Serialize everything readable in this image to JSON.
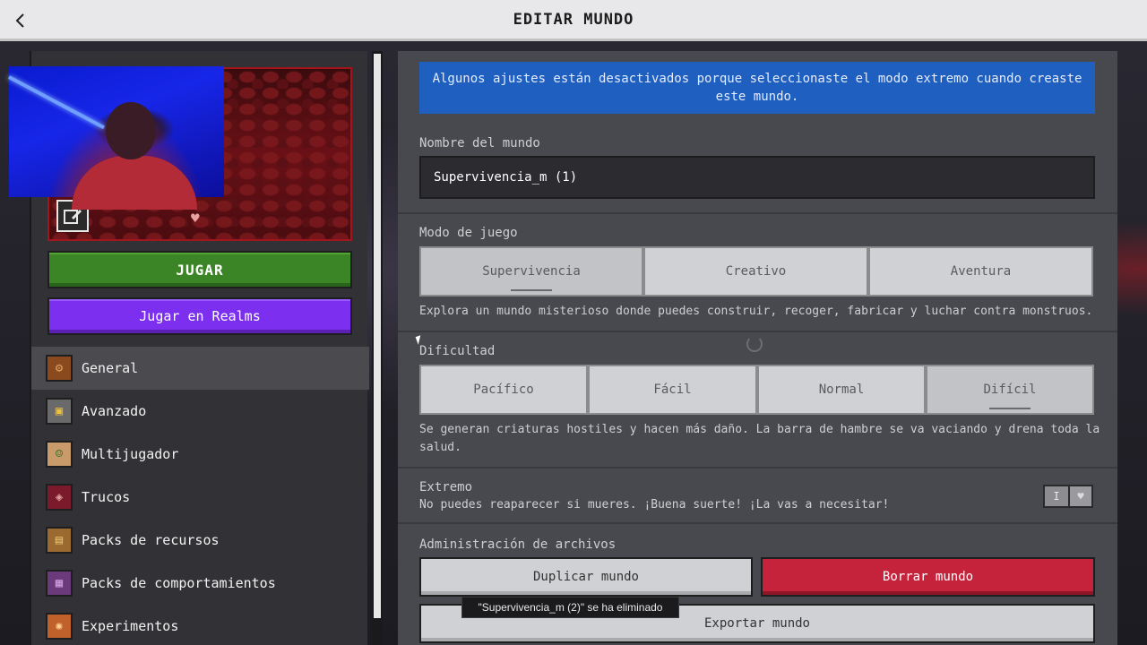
{
  "header": {
    "title": "EDITAR MUNDO",
    "back_icon": "chevron-left-icon"
  },
  "left": {
    "play_label": "JUGAR",
    "realms_label": "Jugar en Realms",
    "nav": [
      {
        "label": "General",
        "icon": "gear-icon",
        "active": true
      },
      {
        "label": "Avanzado",
        "icon": "furnace-icon",
        "active": false
      },
      {
        "label": "Multijugador",
        "icon": "player-head-icon",
        "active": false
      },
      {
        "label": "Trucos",
        "icon": "command-block-icon",
        "active": false
      },
      {
        "label": "Packs de recursos",
        "icon": "chest-icon",
        "active": false
      },
      {
        "label": "Packs de comportamientos",
        "icon": "creeper-icon",
        "active": false
      },
      {
        "label": "Experimentos",
        "icon": "beaker-icon",
        "active": false
      }
    ]
  },
  "main": {
    "banner": "Algunos ajustes están desactivados porque seleccionaste el modo extremo cuando creaste este mundo.",
    "world_name_label": "Nombre del mundo",
    "world_name_value": "Supervivencia_m (1)",
    "game_mode_label": "Modo de juego",
    "game_modes": [
      "Supervivencia",
      "Creativo",
      "Aventura"
    ],
    "game_mode_selected": "Supervivencia",
    "game_mode_desc": "Explora un mundo misterioso donde puedes construir, recoger, fabricar y luchar contra monstruos.",
    "difficulty_label": "Dificultad",
    "difficulties": [
      "Pacífico",
      "Fácil",
      "Normal",
      "Difícil"
    ],
    "difficulty_selected": "Difícil",
    "difficulty_desc": "Se generan criaturas hostiles y hacen más daño. La barra de hambre se va vaciando y drena toda la salud.",
    "hardcore_label": "Extremo",
    "hardcore_desc": "No puedes reaparecer si mueres. ¡Buena suerte! ¡La vas a necesitar!",
    "hardcore_on": true,
    "files_label": "Administración de archivos",
    "duplicate_label": "Duplicar mundo",
    "delete_label": "Borrar mundo",
    "export_label": "Exportar mundo",
    "toast": "\"Supervivencia_m (2)\" se ha eliminado"
  },
  "colors": {
    "play": "#3c8527",
    "realms": "#7d2ff0",
    "banner": "#1e5fbf",
    "delete": "#c4233b"
  }
}
